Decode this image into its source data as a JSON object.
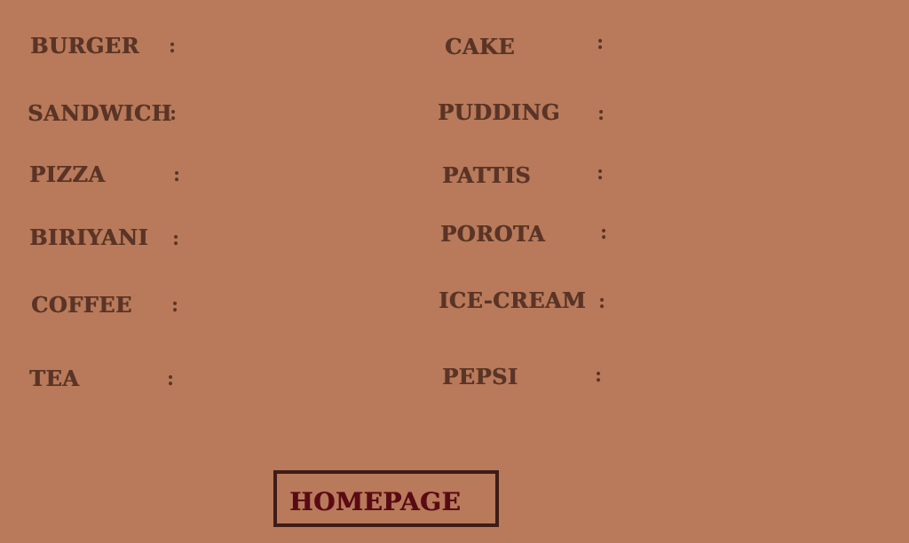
{
  "menu": {
    "left": [
      {
        "label": "BURGER",
        "colon": ":"
      },
      {
        "label": "SANDWICH",
        "colon": ":"
      },
      {
        "label": "PIZZA",
        "colon": ":"
      },
      {
        "label": "BIRIYANI",
        "colon": ":"
      },
      {
        "label": "COFFEE",
        "colon": ":"
      },
      {
        "label": "TEA",
        "colon": ":"
      }
    ],
    "right": [
      {
        "label": "CAKE",
        "colon": ":"
      },
      {
        "label": "PUDDING",
        "colon": ":"
      },
      {
        "label": "PATTIS",
        "colon": ":"
      },
      {
        "label": "POROTA",
        "colon": ":"
      },
      {
        "label": "ICE-CREAM",
        "colon": ":"
      },
      {
        "label": "PEPSI",
        "colon": ":"
      }
    ]
  },
  "homepage_button": {
    "label": "HOMEPAGE"
  },
  "colors": {
    "background": "#b87a5a",
    "label_text": "#5a3426",
    "button_text": "#5a0a14",
    "button_border": "#3e1c18"
  }
}
